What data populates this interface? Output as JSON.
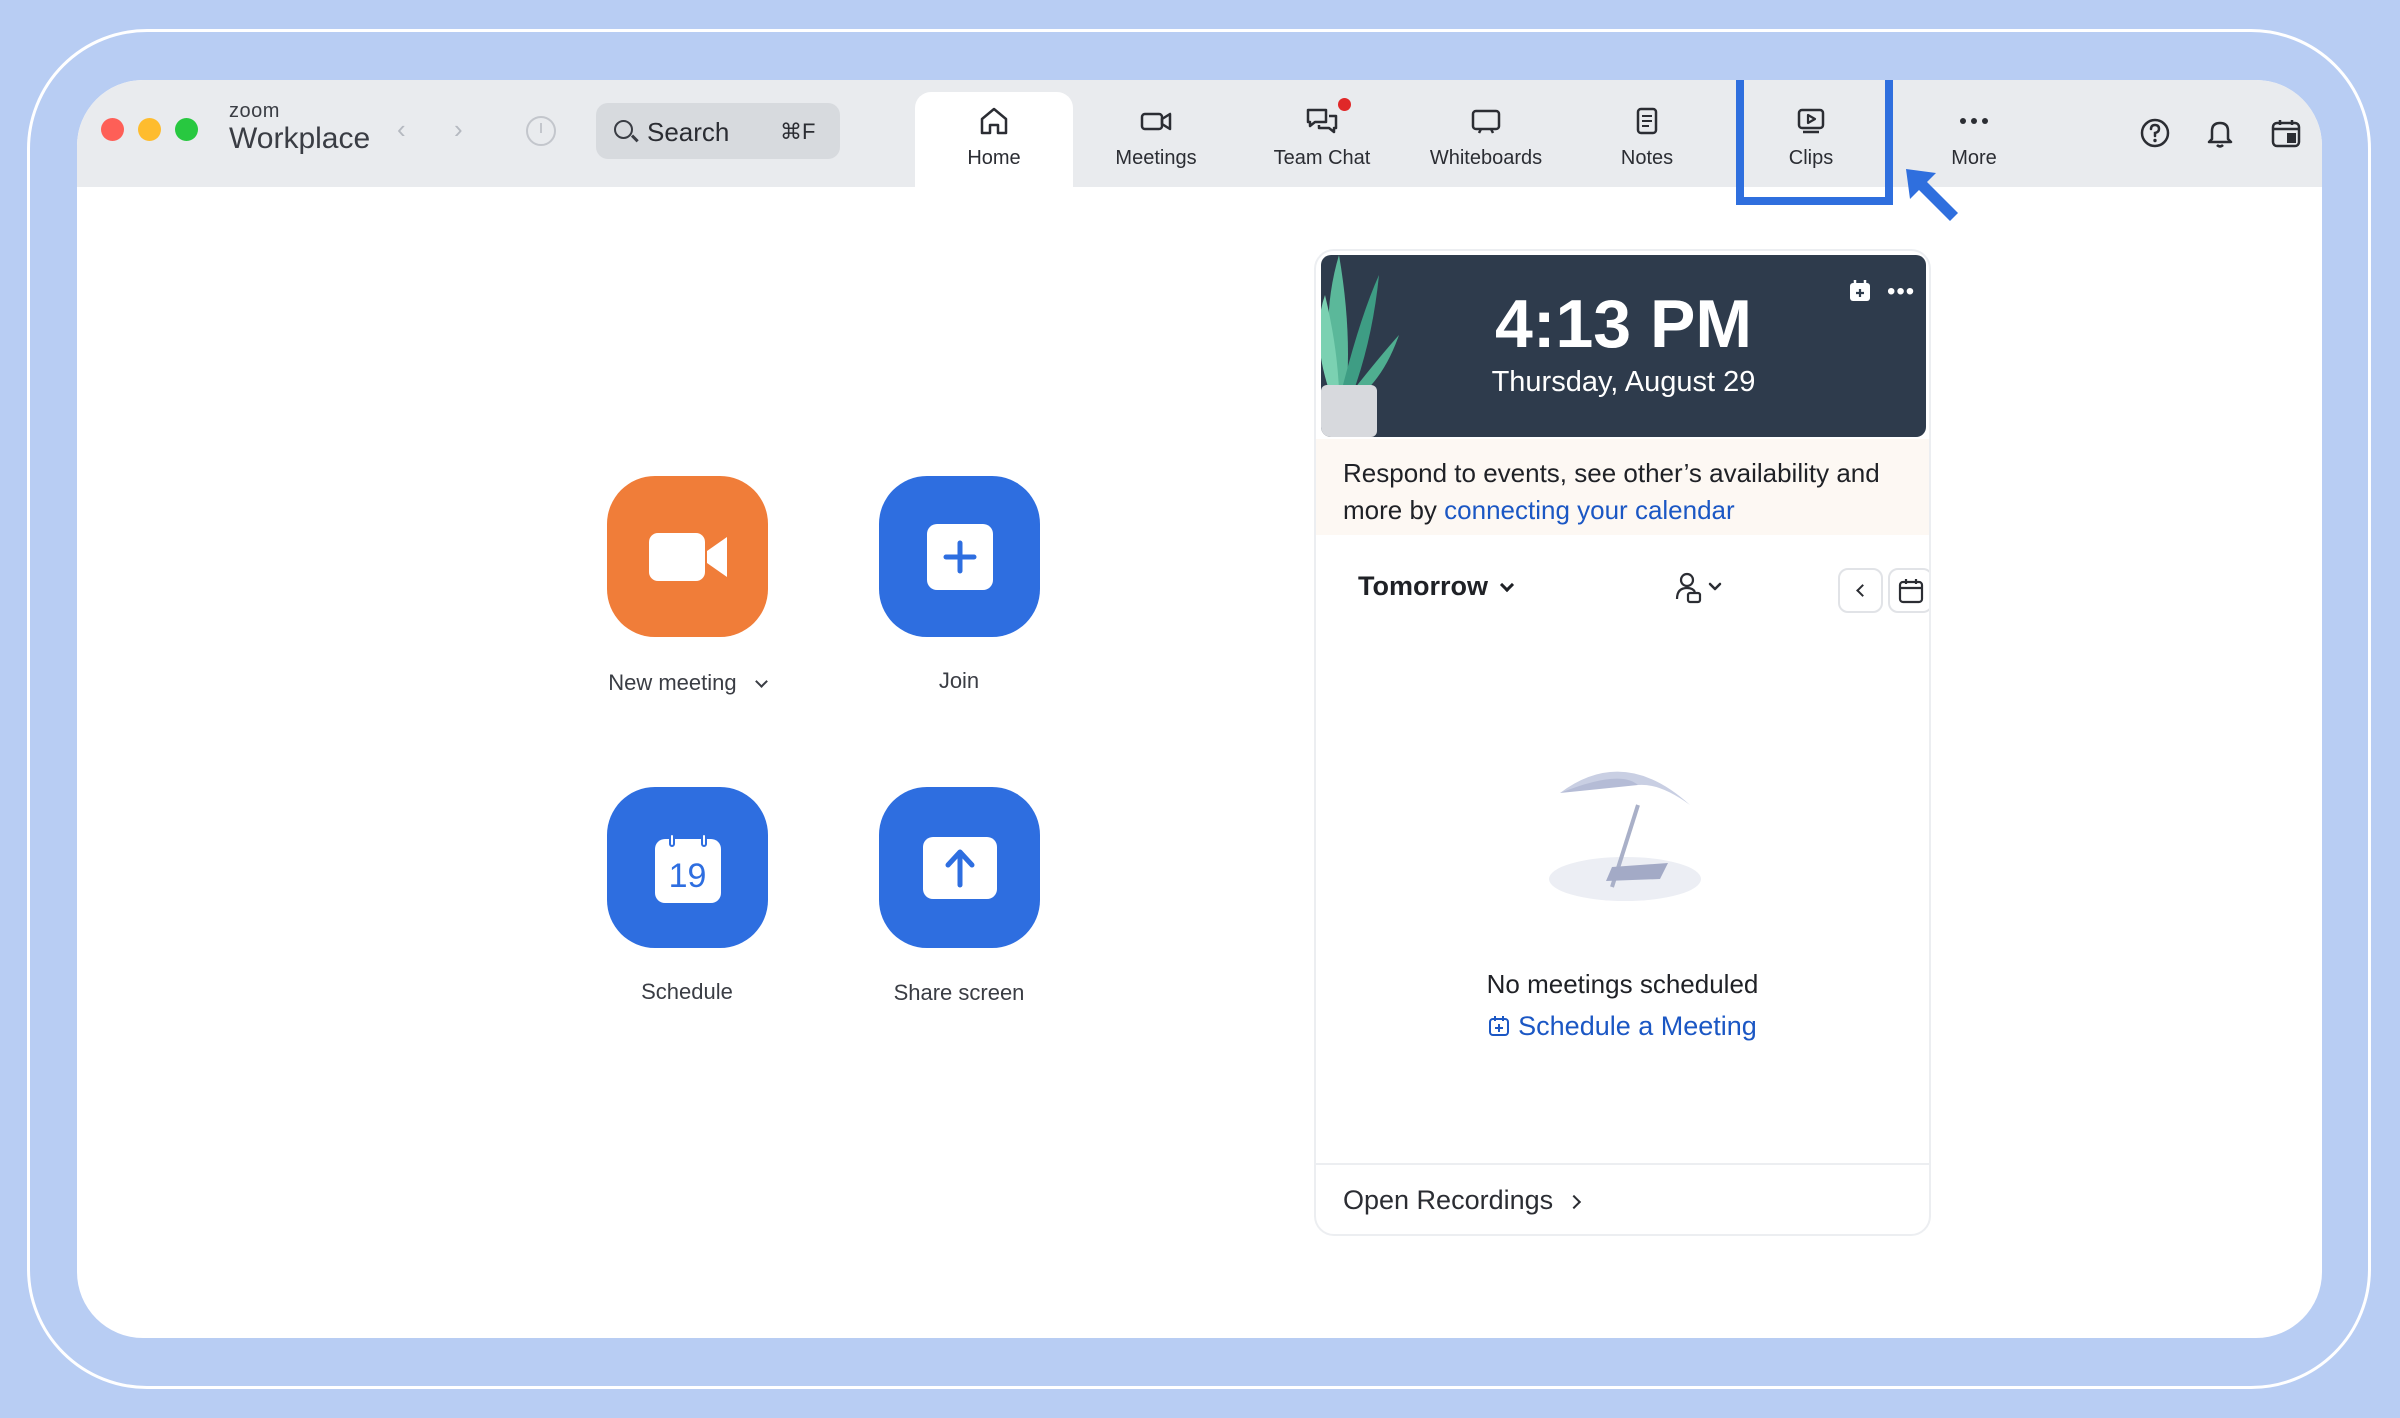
{
  "brand": {
    "small": "zoom",
    "big": "Workplace"
  },
  "search": {
    "label": "Search",
    "shortcut": "⌘F"
  },
  "tabs": [
    {
      "label": "Home",
      "icon": "home-icon",
      "active": true
    },
    {
      "label": "Meetings",
      "icon": "video-camera-icon"
    },
    {
      "label": "Team Chat",
      "icon": "chat-icon",
      "badge": true
    },
    {
      "label": "Whiteboards",
      "icon": "whiteboard-icon"
    },
    {
      "label": "Notes",
      "icon": "notes-icon"
    },
    {
      "label": "Clips",
      "icon": "clips-icon",
      "highlighted": true
    },
    {
      "label": "More",
      "icon": "more-icon"
    }
  ],
  "actions": {
    "new_meeting": "New meeting",
    "join": "Join",
    "schedule": "Schedule",
    "schedule_day": "19",
    "share_screen": "Share screen"
  },
  "panel": {
    "time": "4:13 PM",
    "date": "Thursday, August 29",
    "notice_text": "Respond to events, see other’s availability and more by ",
    "notice_link": "connecting your calendar",
    "day_select": "Tomorrow",
    "empty_text": "No meetings scheduled",
    "schedule_link": "Schedule a Meeting",
    "footer": "Open Recordings"
  },
  "colors": {
    "background": "#b8cdf3",
    "accent_blue": "#2e6ee0",
    "accent_orange": "#f07d39",
    "highlight": "#2f6fde",
    "panel_header": "#2e3b4c",
    "link": "#1b57c4"
  }
}
